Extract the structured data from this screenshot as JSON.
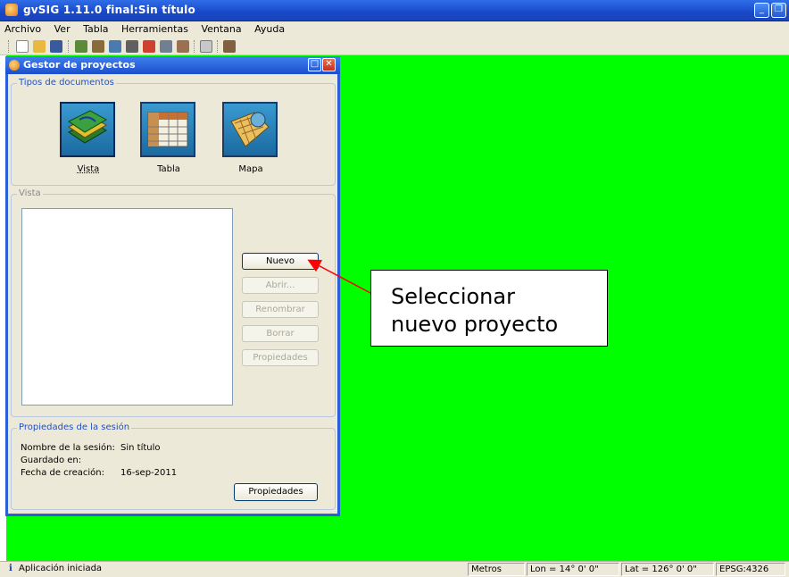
{
  "window": {
    "title": "gvSIG 1.11.0 final:Sin título"
  },
  "menu": {
    "items": [
      "Archivo",
      "Ver",
      "Tabla",
      "Herramientas",
      "Ventana",
      "Ayuda"
    ]
  },
  "toolbar": {
    "icons": [
      "new-project-icon",
      "open-project-icon",
      "save-icon",
      "add-layer-icon",
      "add-event-icon",
      "cad-icon",
      "export-icon",
      "georef-icon",
      "edit-icon",
      "cad-layer-icon",
      "locator-icon",
      "tools-icon"
    ]
  },
  "gestor": {
    "title": "Gestor de proyectos",
    "doc_types_label": "Tipos de documentos",
    "doc_types": [
      {
        "label": "Vista",
        "icon": "vista-icon"
      },
      {
        "label": "Tabla",
        "icon": "tabla-icon"
      },
      {
        "label": "Mapa",
        "icon": "mapa-icon"
      }
    ],
    "list_label": "Vista",
    "buttons": {
      "nuevo": "Nuevo",
      "abrir": "Abrir...",
      "renombrar": "Renombrar",
      "borrar": "Borrar",
      "propiedades": "Propiedades"
    },
    "session": {
      "label": "Propiedades de la sesión",
      "name_label": "Nombre de la sesión:",
      "name_value": "Sin título",
      "saved_label": "Guardado en:",
      "saved_value": "",
      "created_label": "Fecha de creación:",
      "created_value": "16-sep-2011",
      "properties_button": "Propiedades"
    }
  },
  "callout": {
    "line1": "Seleccionar",
    "line2": "nuevo proyecto"
  },
  "status": {
    "message": "Aplicación iniciada",
    "units": "Metros",
    "lon": "Lon = 14° 0' 0\"",
    "lat": "Lat = 126° 0' 0\"",
    "epsg": "EPSG:4326"
  },
  "colors": {
    "canvas": "#00ff00",
    "titlebar": "#1c4fcc",
    "arrow": "#ff0000"
  }
}
